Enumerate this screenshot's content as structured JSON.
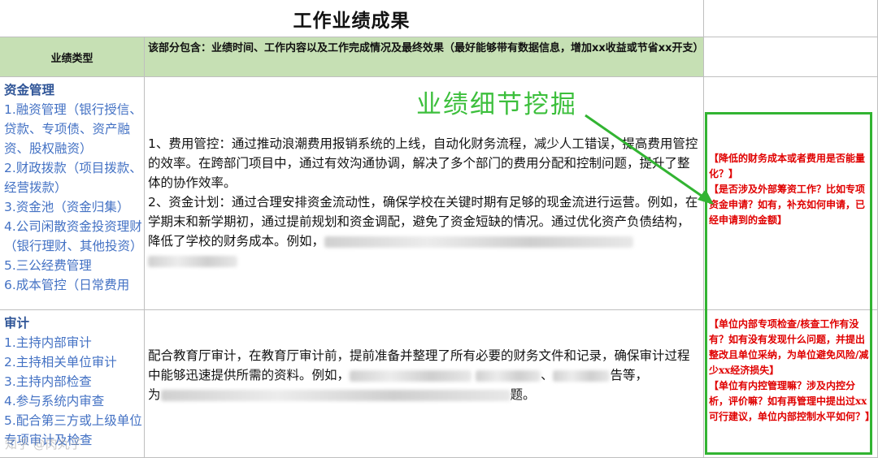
{
  "title": "工作业绩成果",
  "header": {
    "type_label": "业绩类型",
    "desc_label": "该部分包含：业绩时间、工作内容以及工作完成情况及最终效果（最好能够带有数据信息，增加xx收益或节省xx开支）"
  },
  "rows": [
    {
      "heading": "资金管理",
      "items": [
        "1.融资管理（银行授信、贷款、专项债、资产融资、股权融资）",
        "2.财政拨款（项目拨款、经营拨款）",
        "3.资金池（资金归集）",
        "4.公司闲散资金投资理财（银行理财、其他投资）",
        "5.三公经费管理",
        "6.成本管控（日常费用"
      ],
      "para1": "1、费用管控：通过推动浪潮费用报销系统的上线，自动化财务流程，减少人工错误，提高费用管控的效率。在跨部门项目中，通过有效沟通协调，解决了多个部门的费用分配和控制问题，提升了整体的协作效率。",
      "para2": "2、资金计划：通过合理安排资金流动性，确保学校在关键时期有足够的现金流进行运营。例如，在学期末和新学期初，通过提前规划和资金调配，避免了资金短缺的情况。通过优化资产负债结构，降低了学校的财务成本。例如，"
    },
    {
      "heading": "审计",
      "items": [
        "1.主持内部审计",
        "2.主持相关单位审计",
        "3.主持内部检查",
        "4.参与系统内审查",
        "5.配合第三方或上级单位专项审计及检查"
      ],
      "para1": "配合教育厅审计，在教育厅审计前，提前准备并整理了所有必要的财务文件和记录，确保审计过程中能够迅速提供所需的资料。例如，",
      "frag_a": "、",
      "frag_b": "告等，",
      "para_tail_prefix": "为",
      "para_tail_suffix": "题。"
    }
  ],
  "callout": "业绩细节挖掘",
  "notes": {
    "note1": "【降低的财务成本或者费用是否能量化？】\n【是否涉及外部筹资工作？比如专项资金申请？如有，补充如何申请，已经申请到的金额】",
    "note2": "【单位内部专项检查/核查工作有没有？如有没有发现什么问题，并提出整改且单位采纳，为单位避免风险/减少xx经济损失】\n【单位有内控管理嘛？涉及内控分析，评价嘛？如有再管理中提出过xx可行建议，单位内部控制水平如何？】"
  },
  "watermark": "知乎 @肉丸子",
  "colors": {
    "header_bg": "#c6e0b4",
    "accent_green": "#32b432",
    "note_red": "#e00000",
    "link_blue": "#4472c4"
  }
}
